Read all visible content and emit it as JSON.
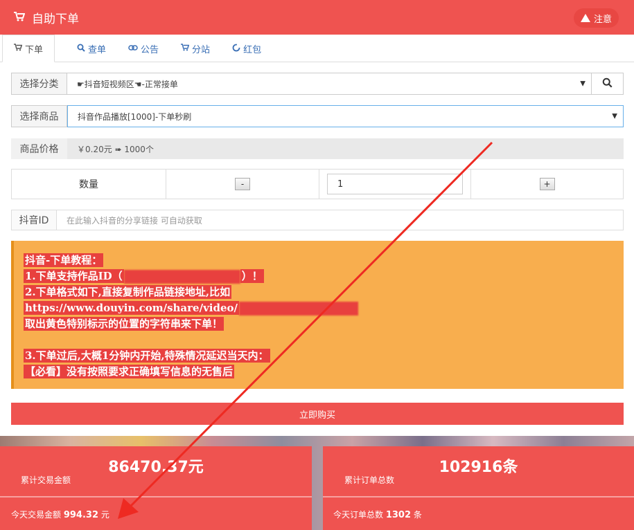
{
  "header": {
    "title": "自助下单",
    "notice_label": "注意"
  },
  "tabs": [
    {
      "label": "下单",
      "icon": "cart-icon"
    },
    {
      "label": "查单",
      "icon": "search-icon"
    },
    {
      "label": "公告",
      "icon": "link-icon"
    },
    {
      "label": "分站",
      "icon": "cart-icon"
    },
    {
      "label": "红包",
      "icon": "spinner-icon"
    }
  ],
  "form": {
    "category_label": "选择分类",
    "category_value": "☛抖音短视频区☚-正常接单",
    "product_label": "选择商品",
    "product_value": "抖音作品播放[1000]-下单秒刷",
    "price_label": "商品价格",
    "price_value": "￥0.20元 ➠ 1000个",
    "quantity_label": "数量",
    "minus_label": "-",
    "quantity_value": "1",
    "plus_label": "+",
    "douyin_label": "抖音ID",
    "douyin_placeholder": "在此输入抖音的分享链接 可自动获取"
  },
  "tutorial": {
    "line1": "抖音-下单教程：",
    "line2a": "1.下单支持作品ID（",
    "line2b": "）！",
    "line3": "2.下单格式如下,直接复制作品链接地址,比如",
    "line4": "https://www.douyin.com/share/video/",
    "line5": "取出黄色特别标示的位置的字符串来下单！",
    "line6": "3.下单过后,大概1分钟内开始,特殊情况延迟当天内：",
    "line7": "【必看】没有按照要求正确填写信息的无售后"
  },
  "buy_button": "立即购买",
  "stats": {
    "total_amount": "86470.37元",
    "total_amount_label": "累计交易金额",
    "today_amount_label": "今天交易金额",
    "today_amount_value": "994.32",
    "today_amount_unit": "元",
    "total_orders": "102916条",
    "total_orders_label": "累计订单总数",
    "today_orders_label": "今天订单总数",
    "today_orders_value": "1302",
    "today_orders_unit": "条"
  },
  "colors": {
    "primary": "#ef5350",
    "tutorial_bg": "#f8ae4e",
    "tab_link": "#3a6fb5"
  }
}
